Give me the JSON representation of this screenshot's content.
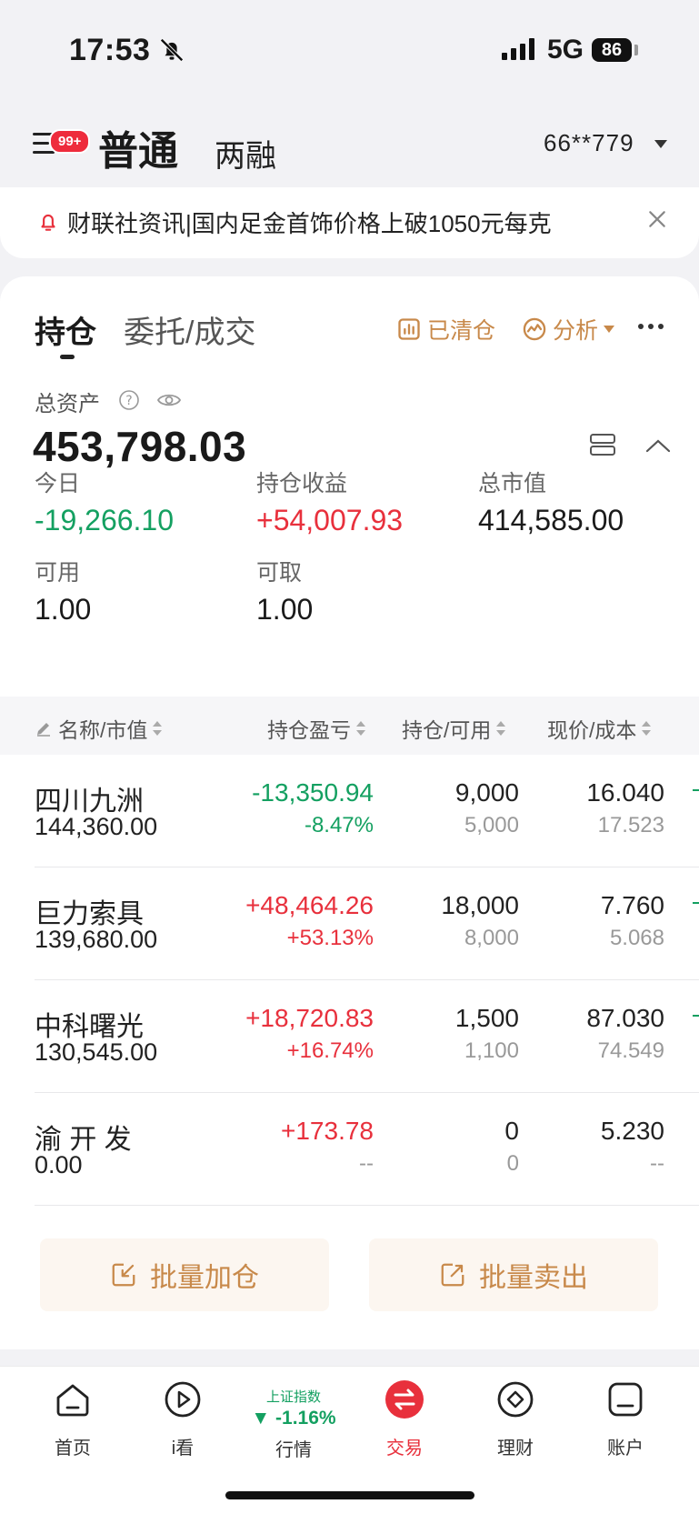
{
  "status_bar": {
    "time": "17:53",
    "network": "5G",
    "battery": "86"
  },
  "header": {
    "badge": "99+",
    "tab_active": "普通",
    "tab_other": "两融",
    "account": "66**779"
  },
  "notice": {
    "text": "财联社资讯|国内足金首饰价格上破1050元每克"
  },
  "tabs": {
    "holdings": "持仓",
    "orders": "委托/成交"
  },
  "actions": {
    "cleared": "已清仓",
    "analysis": "分析"
  },
  "summary": {
    "total_assets_label": "总资产",
    "total_assets": "453,798.03",
    "today_label": "今日",
    "today": "-19,266.10",
    "holding_pl_label": "持仓收益",
    "holding_pl": "+54,007.93",
    "market_value_label": "总市值",
    "market_value": "414,585.00",
    "available_label": "可用",
    "available": "1.00",
    "withdrawable_label": "可取",
    "withdrawable": "1.00"
  },
  "table": {
    "headers": [
      "名称/市值",
      "持仓盈亏",
      "持仓/可用",
      "现价/成本"
    ],
    "rows": [
      {
        "name": "四川九洲",
        "market_value": "144,360.00",
        "pl": "-13,350.94",
        "pl_pct": "-8.47%",
        "qty": "9,000",
        "avail": "5,000",
        "price": "16.040",
        "cost": "17.523",
        "dir": "down"
      },
      {
        "name": "巨力索具",
        "market_value": "139,680.00",
        "pl": "+48,464.26",
        "pl_pct": "+53.13%",
        "qty": "18,000",
        "avail": "8,000",
        "price": "7.760",
        "cost": "5.068",
        "dir": "up"
      },
      {
        "name": "中科曙光",
        "market_value": "130,545.00",
        "pl": "+18,720.83",
        "pl_pct": "+16.74%",
        "qty": "1,500",
        "avail": "1,100",
        "price": "87.030",
        "cost": "74.549",
        "dir": "up"
      },
      {
        "name": "渝 开 发",
        "market_value": "0.00",
        "pl": "+173.78",
        "pl_pct": "--",
        "qty": "0",
        "avail": "0",
        "price": "5.230",
        "cost": "--",
        "dir": "up"
      }
    ]
  },
  "bulk": {
    "add": "批量加仓",
    "sell": "批量卖出"
  },
  "nav": {
    "home": "首页",
    "watch": "i看",
    "market": "行情",
    "index_name": "上证指数",
    "index_value": "▼ -1.16%",
    "trade": "交易",
    "finance": "理财",
    "account": "账户"
  },
  "colors": {
    "up": "#e8303c",
    "down": "#14a061",
    "accent": "#c8894a"
  }
}
